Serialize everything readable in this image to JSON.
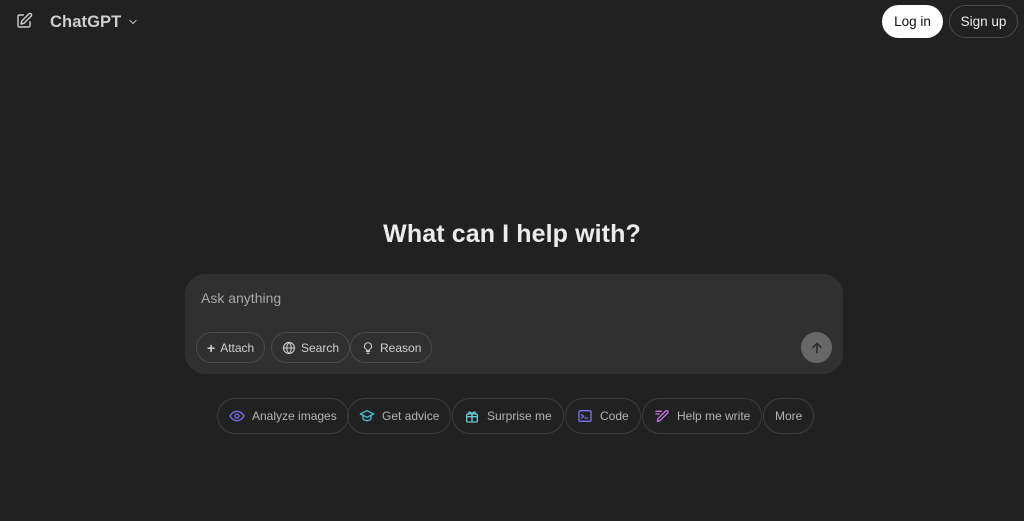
{
  "header": {
    "model_name": "ChatGPT",
    "login_label": "Log in",
    "signup_label": "Sign up"
  },
  "main": {
    "heading": "What can I help with?"
  },
  "composer": {
    "placeholder": "Ask anything",
    "tools": [
      {
        "label": "Attach",
        "prefix": "+",
        "icon": "plus-icon"
      },
      {
        "label": "Search",
        "icon": "globe-icon"
      },
      {
        "label": "Reason",
        "icon": "lightbulb-icon"
      }
    ],
    "send_icon": "arrow-up-icon"
  },
  "suggestions": [
    {
      "label": "Analyze images",
      "icon": "eye-icon",
      "color": "#7b6ff0"
    },
    {
      "label": "Get advice",
      "icon": "graduation-cap-icon",
      "color": "#47c1d1"
    },
    {
      "label": "Surprise me",
      "icon": "gift-icon",
      "color": "#68c6d6"
    },
    {
      "label": "Code",
      "icon": "terminal-icon",
      "color": "#7a74f0"
    },
    {
      "label": "Help me write",
      "icon": "pen-icon",
      "color": "#c774e8"
    },
    {
      "label": "More"
    }
  ],
  "colors": {
    "background": "#212121",
    "composer": "#303030",
    "login_button": "#ffffff",
    "send_button": "#676767"
  }
}
